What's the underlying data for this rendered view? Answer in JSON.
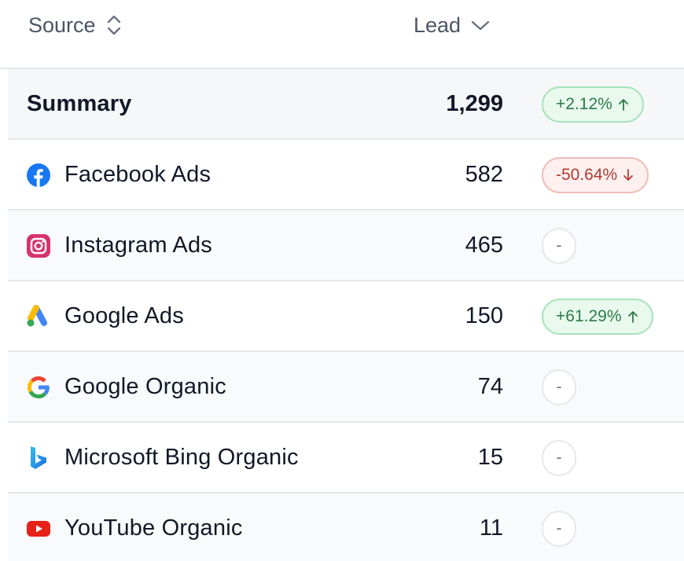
{
  "columns": {
    "source_label": "Source",
    "lead_label": "Lead"
  },
  "summary": {
    "label": "Summary",
    "value": "1,299",
    "change": "+2.12%",
    "trend": "up"
  },
  "rows": [
    {
      "name": "Facebook Ads",
      "icon": "facebook-icon",
      "value": "582",
      "change": "-50.64%",
      "trend": "down"
    },
    {
      "name": "Instagram Ads",
      "icon": "instagram-icon",
      "value": "465",
      "change": "-",
      "trend": "none"
    },
    {
      "name": "Google Ads",
      "icon": "google-ads-icon",
      "value": "150",
      "change": "+61.29%",
      "trend": "up"
    },
    {
      "name": "Google Organic",
      "icon": "google-icon",
      "value": "74",
      "change": "-",
      "trend": "none"
    },
    {
      "name": "Microsoft Bing Organic",
      "icon": "bing-icon",
      "value": "15",
      "change": "-",
      "trend": "none"
    },
    {
      "name": "YouTube Organic",
      "icon": "youtube-icon",
      "value": "11",
      "change": "-",
      "trend": "none"
    }
  ],
  "colors": {
    "up_text": "#2c7a47",
    "down_text": "#b23b32",
    "facebook": "#1877f2",
    "instagram": "#d6336c",
    "youtube": "#e62117",
    "bing": "#1b8fd8"
  }
}
